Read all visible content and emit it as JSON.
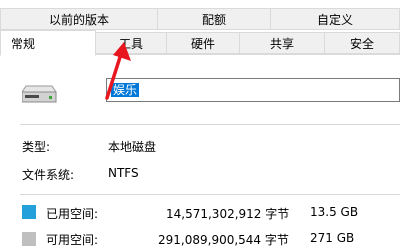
{
  "tabs_top": [
    {
      "label": "以前的版本"
    },
    {
      "label": "配额"
    },
    {
      "label": "自定义"
    }
  ],
  "tabs_bottom": [
    {
      "label": "常规",
      "active": true
    },
    {
      "label": "工具"
    },
    {
      "label": "硬件"
    },
    {
      "label": "共享"
    },
    {
      "label": "安全"
    }
  ],
  "general": {
    "drive_name": "娱乐",
    "type_label": "类型:",
    "type_value": "本地磁盘",
    "fs_label": "文件系统:",
    "fs_value": "NTFS"
  },
  "space": {
    "used": {
      "label": "已用空间:",
      "bytes": "14,571,302,912 字节",
      "size": "13.5 GB",
      "color": "#26a0da"
    },
    "free": {
      "label": "可用空间:",
      "bytes": "291,089,900,544 字节",
      "size": "271 GB",
      "color": "#bfbfbf"
    }
  },
  "colors": {
    "arrow": "#e8161f",
    "selection": "#0078d7"
  }
}
